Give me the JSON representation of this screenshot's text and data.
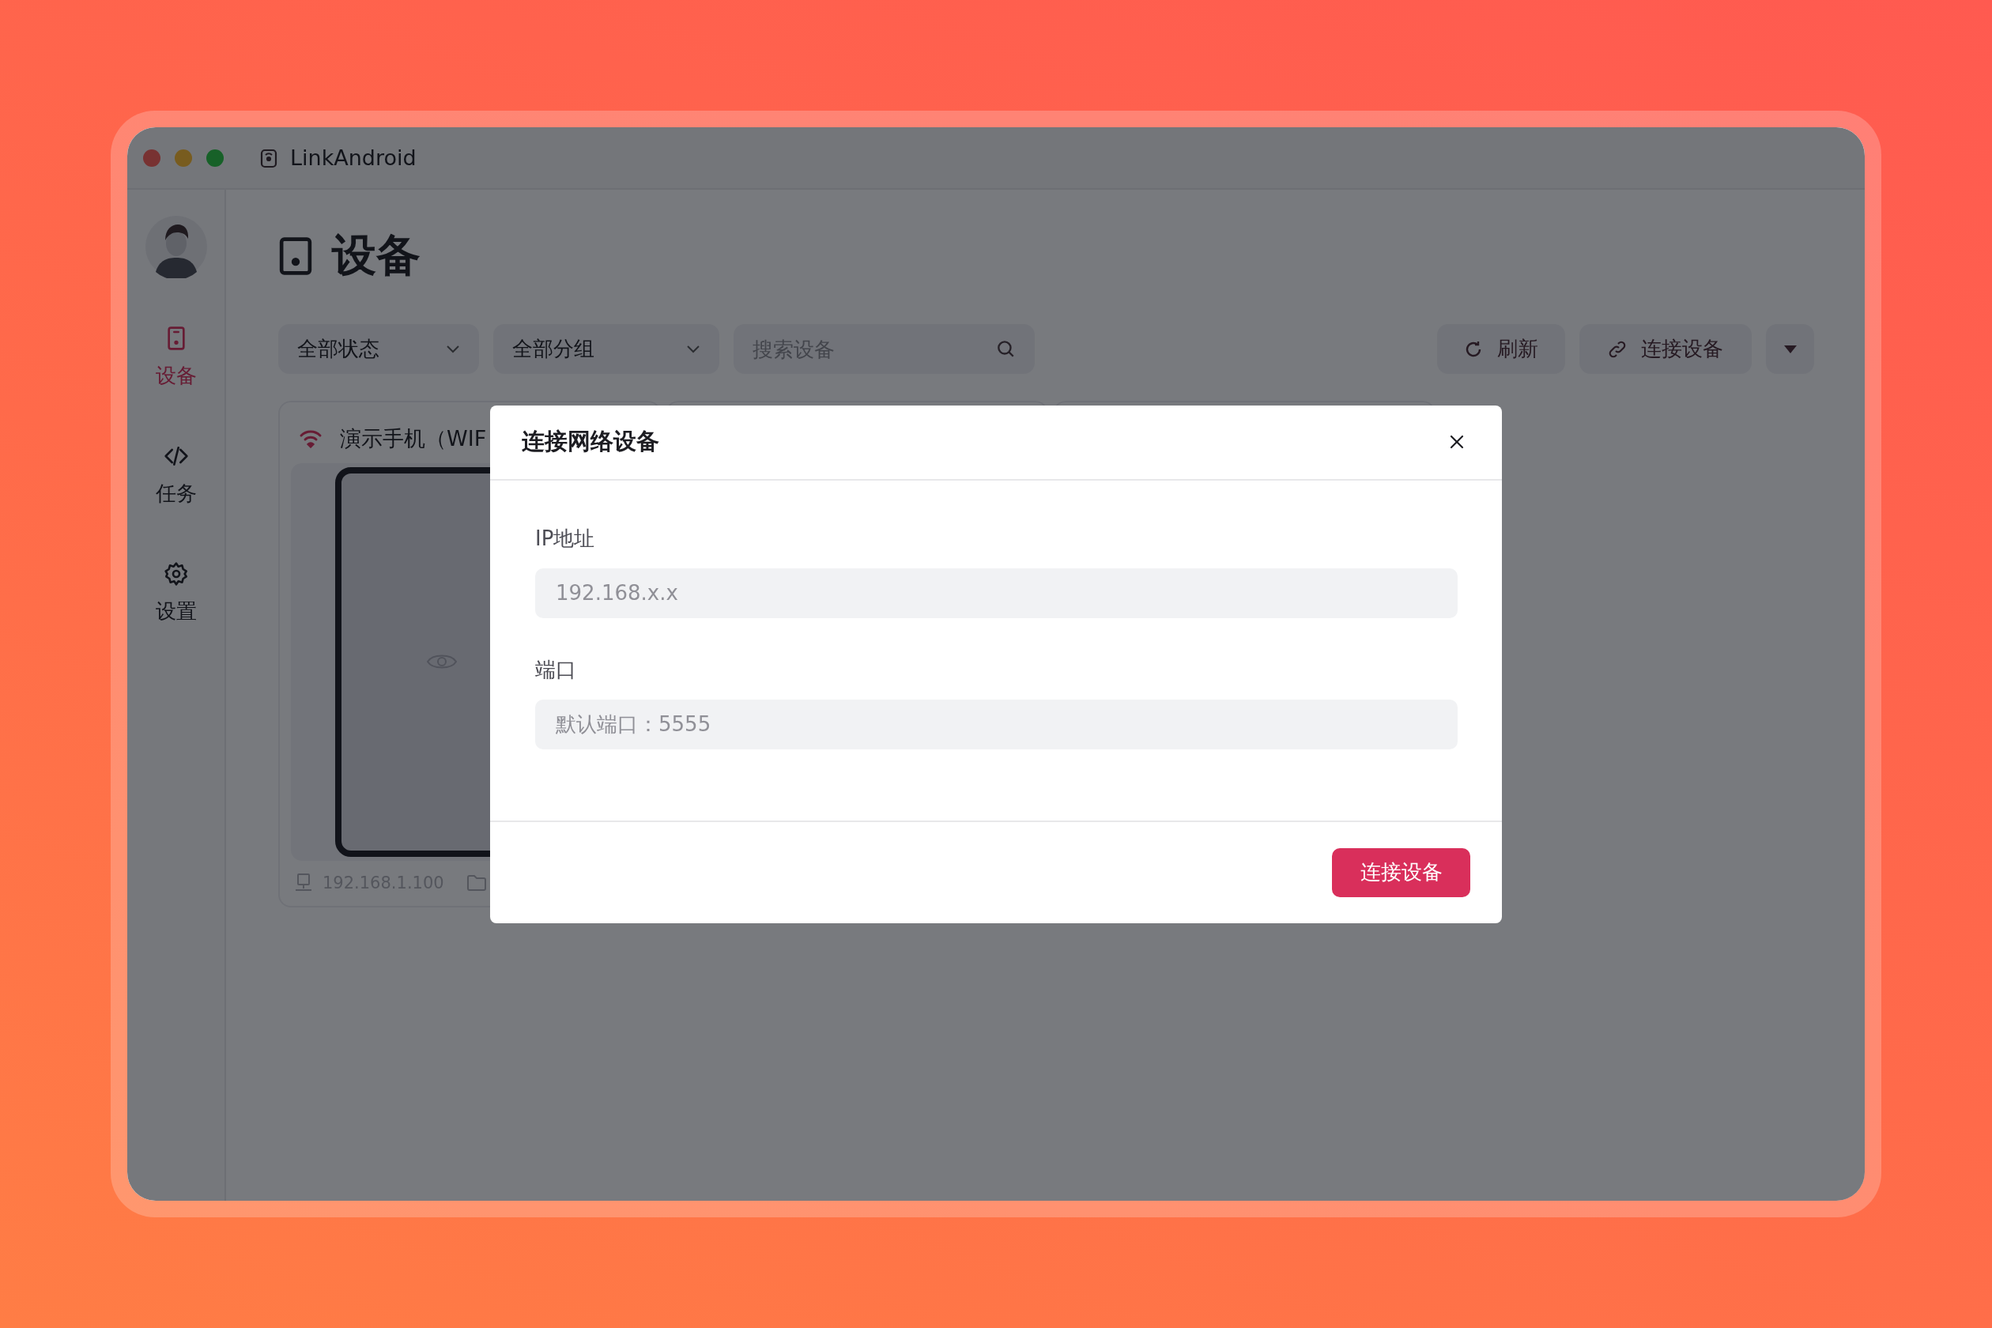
{
  "window": {
    "title": "LinkAndroid"
  },
  "sidebar": {
    "items": [
      {
        "label": "设备",
        "selected": true
      },
      {
        "label": "任务",
        "selected": false
      },
      {
        "label": "设置",
        "selected": false
      }
    ]
  },
  "page": {
    "title": "设备"
  },
  "toolbar": {
    "filters": [
      {
        "value": "全部状态"
      },
      {
        "value": "全部分组"
      }
    ],
    "search": {
      "placeholder": "搜索设备"
    },
    "buttons": [
      {
        "label": "刷新"
      },
      {
        "label": "连接设备"
      }
    ]
  },
  "devices": [
    {
      "name": "演示手机（WIF",
      "ip": "192.168.1.100"
    }
  ],
  "dialog": {
    "title": "连接网络设备",
    "fields": [
      {
        "label": "IP地址",
        "placeholder": "192.168.x.x"
      },
      {
        "label": "端口",
        "placeholder": "默认端口：5555"
      }
    ],
    "submit": "连接设备"
  }
}
